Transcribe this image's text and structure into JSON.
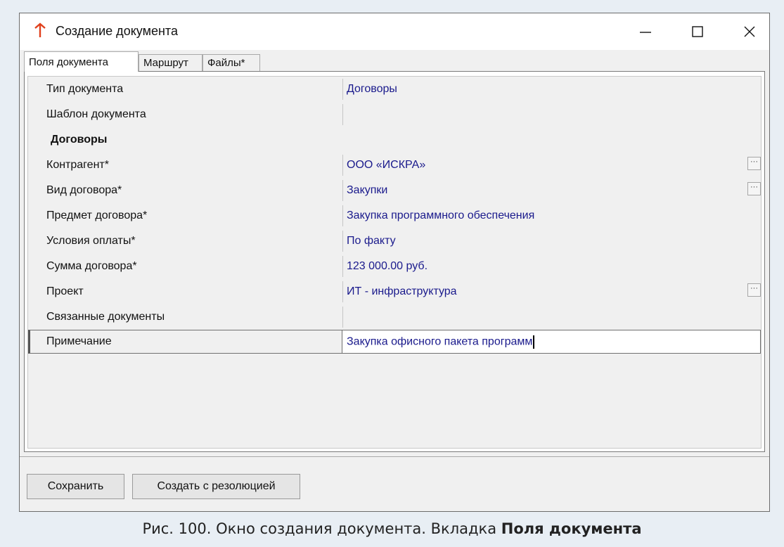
{
  "window": {
    "title": "Создание документа",
    "icon": "red-arrow-up-icon",
    "controls": [
      "minimize-icon",
      "maximize-icon",
      "close-icon"
    ]
  },
  "tabs": [
    {
      "label": "Поля документа",
      "active": true
    },
    {
      "label": "Маршрут",
      "active": false
    },
    {
      "label": "Файлы*",
      "active": false
    }
  ],
  "fields": [
    {
      "label": "Тип документа",
      "value": "Договоры",
      "has_picker": false
    },
    {
      "label": "Шаблон документа",
      "value": "",
      "has_picker": false
    },
    {
      "label": "Договоры",
      "section": true
    },
    {
      "label": "Контрагент*",
      "value": "ООО «ИСКРА»",
      "has_picker": true
    },
    {
      "label": "Вид договора*",
      "value": "Закупки",
      "has_picker": true
    },
    {
      "label": "Предмет договора*",
      "value": "Закупка программного обеспечения",
      "has_picker": false
    },
    {
      "label": "Условия оплаты*",
      "value": "По факту",
      "has_picker": false
    },
    {
      "label": "Сумма договора*",
      "value": "123 000.00 руб.",
      "has_picker": false
    },
    {
      "label": "Проект",
      "value": "ИТ - инфраструктура",
      "has_picker": true
    },
    {
      "label": "Связанные документы",
      "value": "",
      "has_picker": false
    },
    {
      "label": "Примечание",
      "value": "Закупка офисного пакета программ",
      "selected": true
    }
  ],
  "picker_label": "···",
  "buttons": {
    "save": "Сохранить",
    "create_with_resolution": "Создать с резолюцией"
  },
  "caption": {
    "prefix": "Рис. 100. Окно создания документа. Вкладка ",
    "bold": "Поля документа"
  },
  "colors": {
    "value_text": "#1a1a8c",
    "icon_red": "#e0401c"
  }
}
